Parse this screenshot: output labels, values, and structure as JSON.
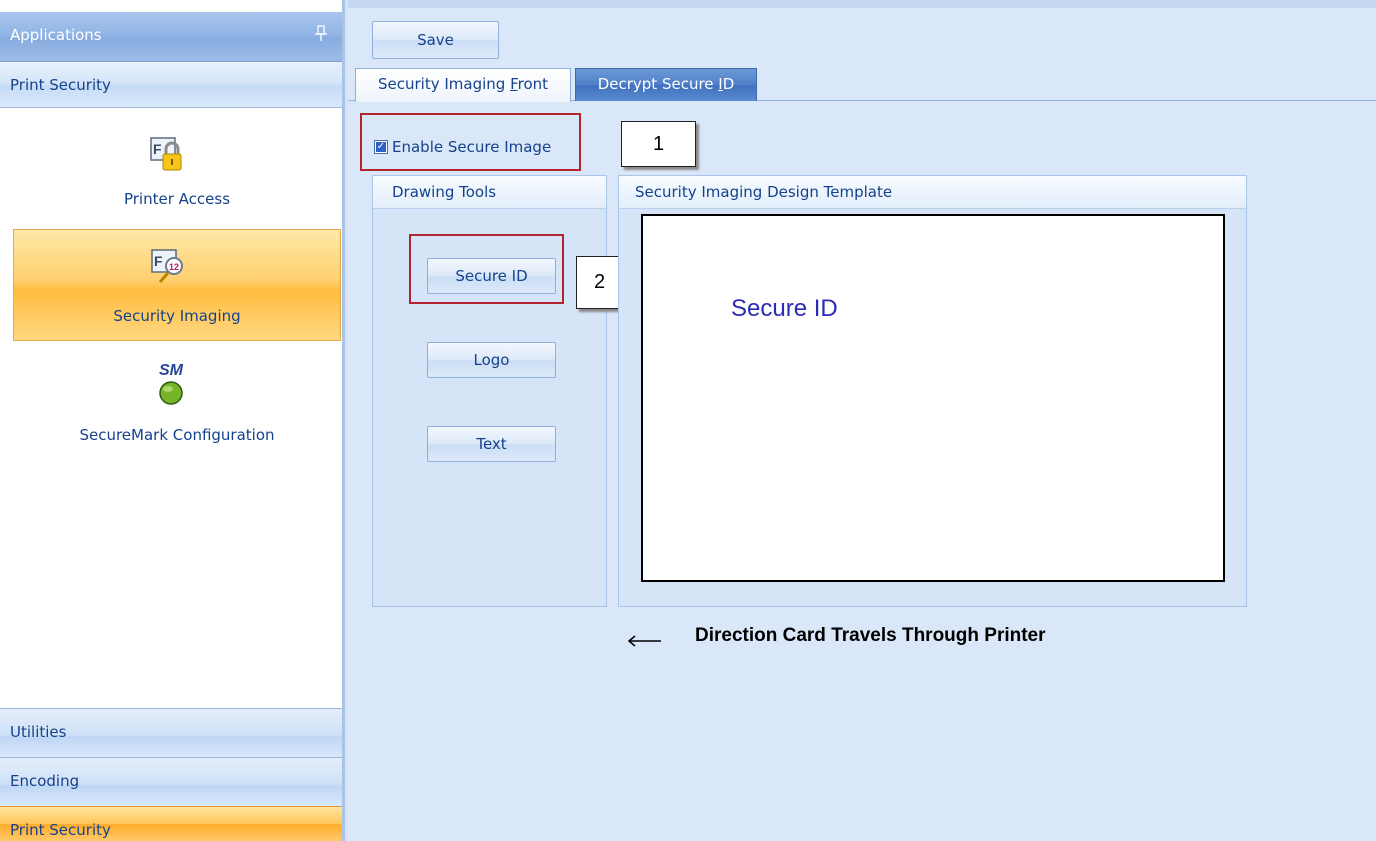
{
  "sidebar": {
    "header_title": "Applications",
    "pin_glyph": "¤",
    "group_title": "Print Security",
    "items": [
      {
        "label": "Printer Access",
        "icon": "lock-card-icon"
      },
      {
        "label": "Security Imaging",
        "icon": "card-magnifier-icon"
      },
      {
        "label": "SecureMark Configuration",
        "icon": "securemark-icon",
        "icon_text": "SM"
      }
    ],
    "bottom_groups": [
      {
        "label": "Utilities"
      },
      {
        "label": "Encoding"
      },
      {
        "label": "Print Security"
      }
    ]
  },
  "toolbar": {
    "save_label": "Save"
  },
  "tabs": [
    {
      "label_pre": "Security Imaging ",
      "label_ul": "F",
      "label_post": "ront"
    },
    {
      "label_pre": "Decrypt Secure ",
      "label_ul": "I",
      "label_post": "D"
    }
  ],
  "enable": {
    "label": "Enable Secure Image",
    "checked": true
  },
  "callouts": [
    "1",
    "2"
  ],
  "drawing_tools": {
    "title": "Drawing Tools",
    "buttons": [
      {
        "label": "Secure ID"
      },
      {
        "label": "Logo"
      },
      {
        "label": "Text"
      }
    ]
  },
  "design_template": {
    "title": "Security Imaging Design Template",
    "canvas_text": "Secure ID"
  },
  "direction_text": "Direction Card Travels Through Printer",
  "colors": {
    "accent_orange": "#ffc458",
    "callout_red": "#b0262b",
    "canvas_text": "#2b2bb5"
  }
}
